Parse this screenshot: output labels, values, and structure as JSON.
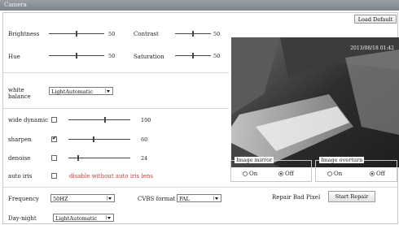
{
  "window": {
    "title": "Camera"
  },
  "toolbar": {
    "load_default_label": "Load Default"
  },
  "video": {
    "timestamp": "2013/08/18 01:42"
  },
  "sliders": [
    {
      "label": "Brightness",
      "value": "50",
      "fraction": 0.5
    },
    {
      "label": "Contrast",
      "value": "50",
      "fraction": 0.5
    },
    {
      "label": "Hue",
      "value": "50",
      "fraction": 0.5
    },
    {
      "label": "Saturation",
      "value": "50",
      "fraction": 0.5
    }
  ],
  "white_balance": {
    "label": "white balance",
    "label_line1": "white",
    "label_line2": "balance",
    "selected": "LightAutomatic"
  },
  "wide_dynamic": {
    "label": "wide dynamic",
    "value": "100",
    "fraction": 0.6,
    "checked": false
  },
  "sharpen": {
    "label": "sharpen",
    "value": "60",
    "fraction": 0.4,
    "checked": true
  },
  "denoise": {
    "label": "denoise",
    "value": "24",
    "fraction": 0.15,
    "checked": false
  },
  "auto_iris": {
    "label": "auto iris",
    "checked": false,
    "note": "disable without auto iris lens"
  },
  "image_mirror": {
    "legend": "Image mirror",
    "on_label": "On",
    "off_label": "Off",
    "selected": "Off"
  },
  "image_overturn": {
    "legend": "Image overturn",
    "on_label": "On",
    "off_label": "Off",
    "selected": "Off"
  },
  "frequency": {
    "label": "Frequency",
    "selected": "50HZ"
  },
  "cvbs_format": {
    "label": "CVBS format",
    "selected": "PAL"
  },
  "repair": {
    "label": "Repair Bad Pixel",
    "button_label": "Start Repair"
  },
  "day_night": {
    "label": "Day-night",
    "selected": "LightAutomatic"
  },
  "colors": {
    "titlebar": "#8a9096",
    "note": "#d23a3a"
  }
}
